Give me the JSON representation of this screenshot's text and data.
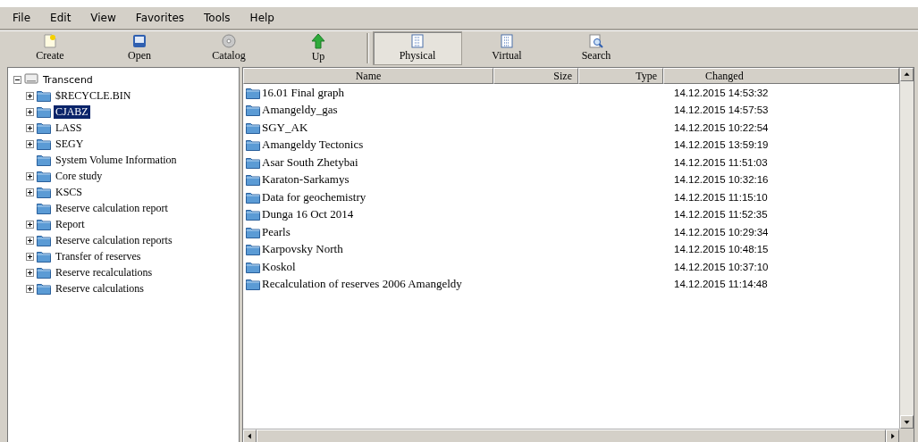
{
  "menu": [
    {
      "label": "File"
    },
    {
      "label": "Edit"
    },
    {
      "label": "View"
    },
    {
      "label": "Favorites"
    },
    {
      "label": "Tools"
    },
    {
      "label": "Help"
    }
  ],
  "toolbar": [
    {
      "kind": "create",
      "label": "Create",
      "selected": false
    },
    {
      "kind": "open",
      "label": "Open",
      "selected": false
    },
    {
      "kind": "catalog",
      "label": "Catalog",
      "selected": false
    },
    {
      "kind": "up",
      "label": "Up",
      "selected": false
    },
    {
      "kind": "physical",
      "label": "Physical",
      "selected": true
    },
    {
      "kind": "virtual",
      "label": "Virtual",
      "selected": false
    },
    {
      "kind": "search",
      "label": "Search",
      "selected": false
    }
  ],
  "tree": {
    "label": "Transcend",
    "expanded": true,
    "children": [
      {
        "label": "$RECYCLE.BIN",
        "expandable": true,
        "selected": false
      },
      {
        "label": "CJABZ",
        "expandable": true,
        "selected": true
      },
      {
        "label": "LASS",
        "expandable": true,
        "selected": false
      },
      {
        "label": "SEGY",
        "expandable": true,
        "selected": false
      },
      {
        "label": "System Volume Information",
        "expandable": false,
        "selected": false
      },
      {
        "label": "Core study",
        "expandable": true,
        "selected": false
      },
      {
        "label": "KSCS",
        "expandable": true,
        "selected": false
      },
      {
        "label": "Reserve calculation report",
        "expandable": false,
        "selected": false
      },
      {
        "label": "Report",
        "expandable": true,
        "selected": false
      },
      {
        "label": "Reserve calculation reports",
        "expandable": true,
        "selected": false
      },
      {
        "label": "Transfer of reserves",
        "expandable": true,
        "selected": false
      },
      {
        "label": "Reserve recalculations",
        "expandable": true,
        "selected": false
      },
      {
        "label": "Reserve calculations",
        "expandable": true,
        "selected": false
      }
    ]
  },
  "table": {
    "columns": [
      "Name",
      "Size",
      "Type",
      "Changed"
    ],
    "rows": [
      {
        "name": "16.01 Final graph",
        "changed": "14.12.2015 14:53:32"
      },
      {
        "name": "Amangeldy_gas",
        "changed": "14.12.2015 14:57:53"
      },
      {
        "name": "SGY_AK",
        "changed": "14.12.2015 10:22:54"
      },
      {
        "name": "Amangeldy Tectonics",
        "changed": "14.12.2015 13:59:19"
      },
      {
        "name": "Asar South Zhetybai",
        "changed": "14.12.2015 11:51:03"
      },
      {
        "name": "Karaton-Sarkamys",
        "changed": "14.12.2015 10:32:16"
      },
      {
        "name": "Data for geochemistry",
        "changed": "14.12.2015 11:15:10"
      },
      {
        "name": "Dunga 16 Oct 2014",
        "changed": "14.12.2015 11:52:35"
      },
      {
        "name": "Pearls",
        "changed": "14.12.2015 10:29:34"
      },
      {
        "name": "Karpovsky North",
        "changed": "14.12.2015 10:48:15"
      },
      {
        "name": "Koskol",
        "changed": "14.12.2015 10:37:10"
      },
      {
        "name": "Recalculation of reserves 2006 Amangeldy",
        "changed": "14.12.2015 11:14:48"
      }
    ]
  }
}
